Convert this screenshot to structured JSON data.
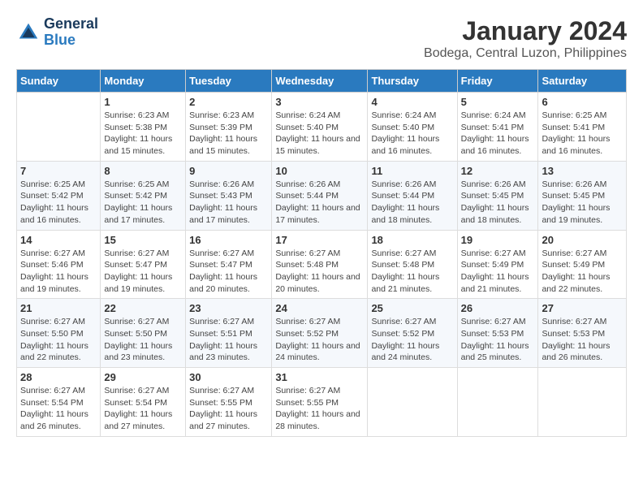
{
  "header": {
    "logo_line1": "General",
    "logo_line2": "Blue",
    "month": "January 2024",
    "location": "Bodega, Central Luzon, Philippines"
  },
  "days_of_week": [
    "Sunday",
    "Monday",
    "Tuesday",
    "Wednesday",
    "Thursday",
    "Friday",
    "Saturday"
  ],
  "weeks": [
    [
      {
        "day": "",
        "info": ""
      },
      {
        "day": "1",
        "info": "Sunrise: 6:23 AM\nSunset: 5:38 PM\nDaylight: 11 hours and 15 minutes."
      },
      {
        "day": "2",
        "info": "Sunrise: 6:23 AM\nSunset: 5:39 PM\nDaylight: 11 hours and 15 minutes."
      },
      {
        "day": "3",
        "info": "Sunrise: 6:24 AM\nSunset: 5:40 PM\nDaylight: 11 hours and 15 minutes."
      },
      {
        "day": "4",
        "info": "Sunrise: 6:24 AM\nSunset: 5:40 PM\nDaylight: 11 hours and 16 minutes."
      },
      {
        "day": "5",
        "info": "Sunrise: 6:24 AM\nSunset: 5:41 PM\nDaylight: 11 hours and 16 minutes."
      },
      {
        "day": "6",
        "info": "Sunrise: 6:25 AM\nSunset: 5:41 PM\nDaylight: 11 hours and 16 minutes."
      }
    ],
    [
      {
        "day": "7",
        "info": "Sunrise: 6:25 AM\nSunset: 5:42 PM\nDaylight: 11 hours and 16 minutes."
      },
      {
        "day": "8",
        "info": "Sunrise: 6:25 AM\nSunset: 5:42 PM\nDaylight: 11 hours and 17 minutes."
      },
      {
        "day": "9",
        "info": "Sunrise: 6:26 AM\nSunset: 5:43 PM\nDaylight: 11 hours and 17 minutes."
      },
      {
        "day": "10",
        "info": "Sunrise: 6:26 AM\nSunset: 5:44 PM\nDaylight: 11 hours and 17 minutes."
      },
      {
        "day": "11",
        "info": "Sunrise: 6:26 AM\nSunset: 5:44 PM\nDaylight: 11 hours and 18 minutes."
      },
      {
        "day": "12",
        "info": "Sunrise: 6:26 AM\nSunset: 5:45 PM\nDaylight: 11 hours and 18 minutes."
      },
      {
        "day": "13",
        "info": "Sunrise: 6:26 AM\nSunset: 5:45 PM\nDaylight: 11 hours and 19 minutes."
      }
    ],
    [
      {
        "day": "14",
        "info": "Sunrise: 6:27 AM\nSunset: 5:46 PM\nDaylight: 11 hours and 19 minutes."
      },
      {
        "day": "15",
        "info": "Sunrise: 6:27 AM\nSunset: 5:47 PM\nDaylight: 11 hours and 19 minutes."
      },
      {
        "day": "16",
        "info": "Sunrise: 6:27 AM\nSunset: 5:47 PM\nDaylight: 11 hours and 20 minutes."
      },
      {
        "day": "17",
        "info": "Sunrise: 6:27 AM\nSunset: 5:48 PM\nDaylight: 11 hours and 20 minutes."
      },
      {
        "day": "18",
        "info": "Sunrise: 6:27 AM\nSunset: 5:48 PM\nDaylight: 11 hours and 21 minutes."
      },
      {
        "day": "19",
        "info": "Sunrise: 6:27 AM\nSunset: 5:49 PM\nDaylight: 11 hours and 21 minutes."
      },
      {
        "day": "20",
        "info": "Sunrise: 6:27 AM\nSunset: 5:49 PM\nDaylight: 11 hours and 22 minutes."
      }
    ],
    [
      {
        "day": "21",
        "info": "Sunrise: 6:27 AM\nSunset: 5:50 PM\nDaylight: 11 hours and 22 minutes."
      },
      {
        "day": "22",
        "info": "Sunrise: 6:27 AM\nSunset: 5:50 PM\nDaylight: 11 hours and 23 minutes."
      },
      {
        "day": "23",
        "info": "Sunrise: 6:27 AM\nSunset: 5:51 PM\nDaylight: 11 hours and 23 minutes."
      },
      {
        "day": "24",
        "info": "Sunrise: 6:27 AM\nSunset: 5:52 PM\nDaylight: 11 hours and 24 minutes."
      },
      {
        "day": "25",
        "info": "Sunrise: 6:27 AM\nSunset: 5:52 PM\nDaylight: 11 hours and 24 minutes."
      },
      {
        "day": "26",
        "info": "Sunrise: 6:27 AM\nSunset: 5:53 PM\nDaylight: 11 hours and 25 minutes."
      },
      {
        "day": "27",
        "info": "Sunrise: 6:27 AM\nSunset: 5:53 PM\nDaylight: 11 hours and 26 minutes."
      }
    ],
    [
      {
        "day": "28",
        "info": "Sunrise: 6:27 AM\nSunset: 5:54 PM\nDaylight: 11 hours and 26 minutes."
      },
      {
        "day": "29",
        "info": "Sunrise: 6:27 AM\nSunset: 5:54 PM\nDaylight: 11 hours and 27 minutes."
      },
      {
        "day": "30",
        "info": "Sunrise: 6:27 AM\nSunset: 5:55 PM\nDaylight: 11 hours and 27 minutes."
      },
      {
        "day": "31",
        "info": "Sunrise: 6:27 AM\nSunset: 5:55 PM\nDaylight: 11 hours and 28 minutes."
      },
      {
        "day": "",
        "info": ""
      },
      {
        "day": "",
        "info": ""
      },
      {
        "day": "",
        "info": ""
      }
    ]
  ]
}
